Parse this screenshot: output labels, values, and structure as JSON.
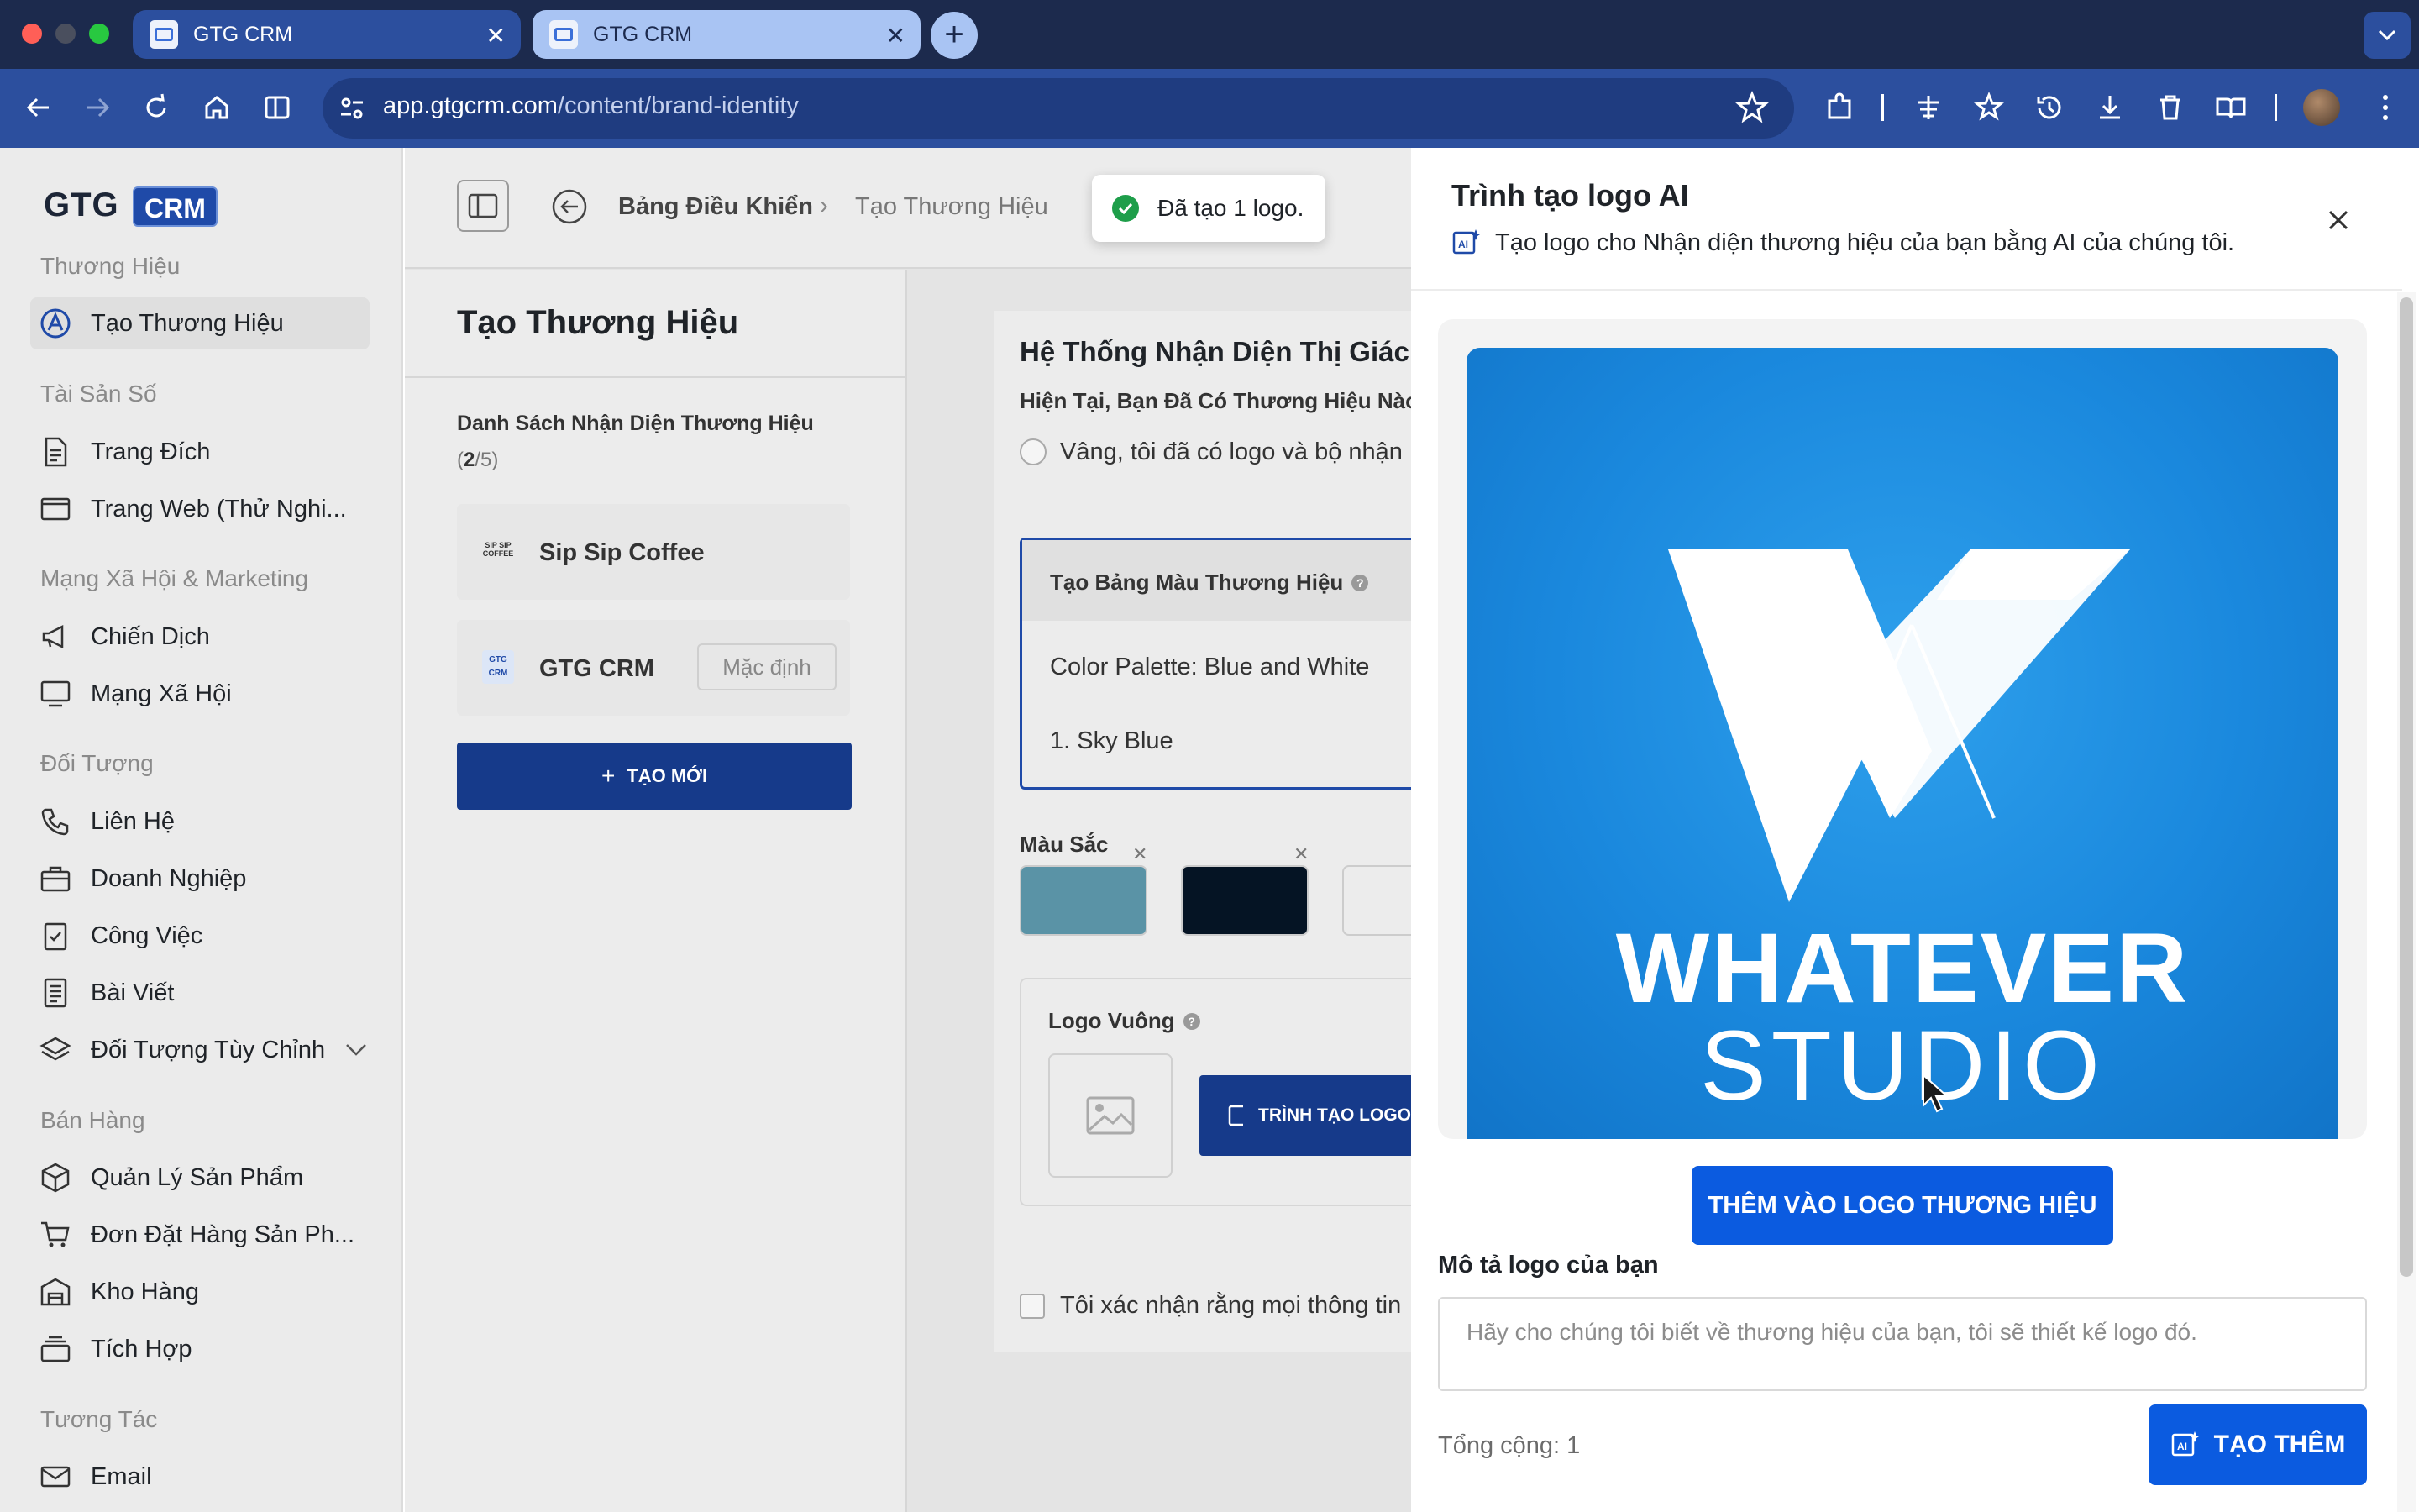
{
  "browser": {
    "tabs": [
      {
        "title": "GTG CRM"
      },
      {
        "title": "GTG CRM"
      }
    ],
    "url_domain": "app.gtgcrm.com",
    "url_path": "/content/brand-identity"
  },
  "brand": {
    "name": "GTG",
    "badge": "CRM"
  },
  "sidebar": {
    "sections": [
      {
        "label": "Thương Hiệu",
        "items": [
          {
            "label": "Tạo Thương Hiệu",
            "icon": "brand-icon"
          }
        ]
      },
      {
        "label": "Tài Sản Số",
        "items": [
          {
            "label": "Trang Đích",
            "icon": "document-icon"
          },
          {
            "label": "Trang Web (Thử Nghi...",
            "icon": "browser-window-icon"
          }
        ]
      },
      {
        "label": "Mạng Xã Hội & Marketing",
        "items": [
          {
            "label": "Chiến Dịch",
            "icon": "megaphone-icon"
          },
          {
            "label": "Mạng Xã Hội",
            "icon": "monitor-icon"
          }
        ]
      },
      {
        "label": "Đối Tượng",
        "items": [
          {
            "label": "Liên Hệ",
            "icon": "phone-icon"
          },
          {
            "label": "Doanh Nghiệp",
            "icon": "briefcase-icon"
          },
          {
            "label": "Công Việc",
            "icon": "clipboard-check-icon"
          },
          {
            "label": "Bài Viết",
            "icon": "article-icon"
          },
          {
            "label": "Đối Tượng Tùy Chỉnh",
            "icon": "layers-icon"
          }
        ]
      },
      {
        "label": "Bán Hàng",
        "items": [
          {
            "label": "Quản Lý Sản Phẩm",
            "icon": "box-icon"
          },
          {
            "label": "Đơn Đặt Hàng Sản Ph...",
            "icon": "cart-icon"
          },
          {
            "label": "Kho Hàng",
            "icon": "warehouse-icon"
          },
          {
            "label": "Tích Hợp",
            "icon": "stack-icon"
          }
        ]
      },
      {
        "label": "Tương Tác",
        "items": [
          {
            "label": "Email",
            "icon": "mail-icon"
          }
        ]
      }
    ]
  },
  "breadcrumb": {
    "home": "Bảng Điều Khiển",
    "current": "Tạo Thương Hiệu"
  },
  "left_panel": {
    "title": "Tạo Thương Hiệu",
    "list_title": "Danh Sách Nhận Diện Thương Hiệu",
    "count_current": "2",
    "count_total": "/5)",
    "count_open": "(",
    "brands": [
      {
        "name": "Sip Sip Coffee",
        "logo_text": "SIP SIP COFFEE"
      },
      {
        "name": "GTG CRM",
        "logo_text": "GTG CRM",
        "badge": "Mặc định"
      }
    ],
    "new_button": "TẠO MỚI"
  },
  "content": {
    "section_title": "Hệ Thống Nhận Diện Thị Giác",
    "question": "Hiện Tại, Bạn Đã Có Thương Hiệu Nào",
    "radio_label": "Vâng, tôi đã có logo và bộ nhận",
    "palette_title": "Tạo Bảng Màu Thương Hiệu",
    "palette_line1": "Color Palette: Blue and White",
    "palette_line2": "1. Sky Blue",
    "colors_label": "Màu Sắc",
    "swatches": [
      "#5a93a6",
      "#051424",
      "#ececec"
    ],
    "logo_label": "Logo Vuông",
    "logo_button": "TRÌNH TẠO LOGO",
    "confirm_label": "Tôi xác nhận rằng mọi thông tin"
  },
  "toast": {
    "message": "Đã tạo 1 logo."
  },
  "drawer": {
    "title": "Trình tạo logo AI",
    "subtitle": "Tạo logo cho Nhận diện thương hiệu của bạn bằng AI của chúng tôi.",
    "logo_text_line1": "WHATEVER",
    "logo_text_line2": "STUDIO",
    "add_button": "THÊM VÀO LOGO THƯƠNG HIỆU",
    "description_label": "Mô tả logo của bạn",
    "description_placeholder": "Hãy cho chúng tôi biết về thương hiệu của bạn, tôi sẽ thiết kế logo đó.",
    "total_label": "Tổng cộng: 1",
    "generate_button": "TẠO THÊM"
  },
  "colors": {
    "primary": "#0b5be0",
    "chrome_dark": "#1c2a4d",
    "chrome_toolbar": "#2c4f9e",
    "success": "#1e9e4a"
  }
}
